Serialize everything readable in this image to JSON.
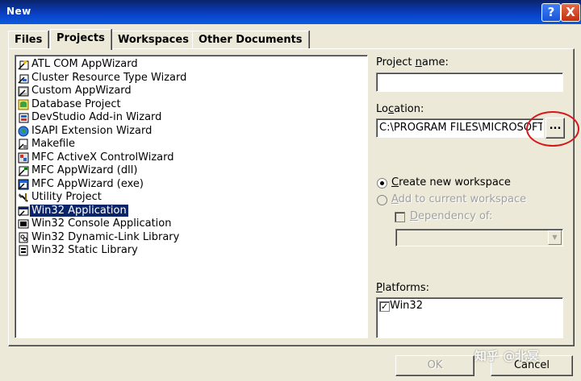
{
  "window": {
    "title": "New"
  },
  "titlebar_buttons": {
    "help": "?",
    "close": "X"
  },
  "tabs": [
    {
      "label": "Files"
    },
    {
      "label": "Projects",
      "active": true
    },
    {
      "label": "Workspaces"
    },
    {
      "label": "Other Documents"
    }
  ],
  "project_types": [
    {
      "label": "ATL COM AppWizard",
      "icon": "atl-wizard-icon"
    },
    {
      "label": "Cluster Resource Type Wizard",
      "icon": "cluster-wizard-icon"
    },
    {
      "label": "Custom AppWizard",
      "icon": "custom-wizard-icon"
    },
    {
      "label": "Database Project",
      "icon": "database-icon"
    },
    {
      "label": "DevStudio Add-in Wizard",
      "icon": "addin-wizard-icon"
    },
    {
      "label": "ISAPI Extension Wizard",
      "icon": "globe-icon"
    },
    {
      "label": "Makefile",
      "icon": "makefile-icon"
    },
    {
      "label": "MFC ActiveX ControlWizard",
      "icon": "activex-icon"
    },
    {
      "label": "MFC AppWizard (dll)",
      "icon": "mfc-dll-icon"
    },
    {
      "label": "MFC AppWizard (exe)",
      "icon": "mfc-exe-icon"
    },
    {
      "label": "Utility Project",
      "icon": "utility-icon"
    },
    {
      "label": "Win32 Application",
      "icon": "win32-app-icon",
      "selected": true
    },
    {
      "label": "Win32 Console Application",
      "icon": "console-icon"
    },
    {
      "label": "Win32 Dynamic-Link Library",
      "icon": "dll-icon"
    },
    {
      "label": "Win32 Static Library",
      "icon": "static-lib-icon"
    }
  ],
  "project_name": {
    "label_pre": "Project ",
    "label_key": "n",
    "label_post": "ame:",
    "value": ""
  },
  "location": {
    "label_pre": "Lo",
    "label_key": "c",
    "label_post": "ation:",
    "value": "C:\\PROGRAM FILES\\MICROSOFT",
    "browse_label": "..."
  },
  "workspace": {
    "create_pre": "",
    "create_key": "C",
    "create_post": "reate new workspace",
    "add_pre": "",
    "add_key": "A",
    "add_post": "dd to current workspace",
    "dependency_pre": "",
    "dependency_key": "D",
    "dependency_post": "ependency of:",
    "selected": "create"
  },
  "platforms": {
    "label_pre": "",
    "label_key": "P",
    "label_post": "latforms:",
    "items": [
      {
        "label": "Win32",
        "checked": true
      }
    ]
  },
  "buttons": {
    "ok": "OK",
    "cancel": "Cancel"
  },
  "watermark": "知乎 @北冥",
  "colors": {
    "title_bar": "#0a3fc2",
    "selection": "#0a246a",
    "annotation": "#d4181c",
    "dialog_bg": "#ece9d8"
  }
}
